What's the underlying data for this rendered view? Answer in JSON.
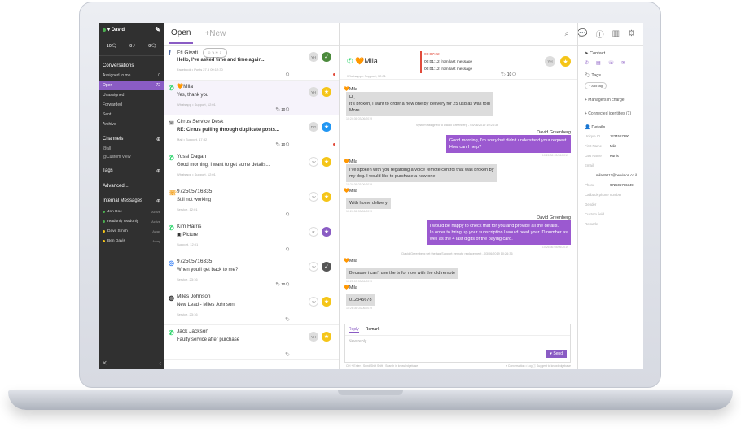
{
  "sidebar": {
    "user": "David",
    "counts": [
      "10🗨",
      "9✓",
      "9🗨"
    ],
    "conversations_h": "Conversations",
    "items": [
      {
        "label": "Assigned to me",
        "count": "0"
      },
      {
        "label": "Open",
        "count": "72"
      },
      {
        "label": "Unassigned",
        "count": ""
      },
      {
        "label": "Forwarded",
        "count": ""
      },
      {
        "label": "Sent",
        "count": ""
      },
      {
        "label": "Archive",
        "count": ""
      }
    ],
    "channels_h": "Channels",
    "channels": [
      "@all",
      "@Custom View"
    ],
    "tags_h": "Tags",
    "advanced": "Advanced...",
    "internal_h": "Internal Messages",
    "internal": [
      {
        "name": "Jon Doe",
        "status": "Active",
        "color": "#4caf50"
      },
      {
        "name": "readonly readonly",
        "status": "Active",
        "color": "#4caf50"
      },
      {
        "name": "Dave Smith",
        "status": "Away",
        "color": "#f5c518"
      },
      {
        "name": "Ben Davis",
        "status": "Away",
        "color": "#f5c518"
      }
    ]
  },
  "list": {
    "tab_open": "Open",
    "tab_new": "+New",
    "rows": [
      {
        "icon": "f",
        "icon_color": "#3b5998",
        "name": "Eti Givati",
        "pill": "☺ ✎ ✂ ⇩",
        "preview": "Hello, I've asked time and time again...",
        "bold": true,
        "meta": "Facebook • Posts 27.5 09:12:30",
        "avatar": "YH",
        "status": "✓",
        "status_color": "#4b8a3c",
        "mini": "🗨",
        "red": true
      },
      {
        "icon": "✆",
        "icon_color": "#25d366",
        "name": "🧡Mila",
        "pill": "",
        "preview": "Yes, thank you",
        "bold": false,
        "meta": "Whatsapp • Support, 12:01",
        "avatar": "YH",
        "status": "★",
        "status_color": "#f5c518",
        "mini": "🏷 10🗨",
        "red": false
      },
      {
        "icon": "✉",
        "icon_color": "#777777",
        "name": "Cirrus Service Desk",
        "pill": "",
        "preview": "RE: Cirrus pulling through duplicate posts...",
        "bold": true,
        "meta": "Mail • Support, 17:32",
        "avatar": "DG",
        "status": "★",
        "status_color": "#2196f3",
        "mini": "🏷 10🗨",
        "red": true
      },
      {
        "icon": "✆",
        "icon_color": "#25d366",
        "name": "Yossi Dagan",
        "pill": "",
        "preview": "Good morning, I want to get some details...",
        "bold": false,
        "meta": "Whatsapp • Support, 12:01",
        "avatar": "JV",
        "status": "★",
        "status_color": "#f5c518",
        "mini": "",
        "red": false
      },
      {
        "icon": "☏",
        "icon_color": "#f39c12",
        "name": "972505716335",
        "pill": "",
        "preview": "Still not working",
        "bold": false,
        "meta": "Service, 12:01",
        "avatar": "JV",
        "status": "★",
        "status_color": "#f5c518",
        "mini": "🗨",
        "red": false
      },
      {
        "icon": "✆",
        "icon_color": "#25d366",
        "name": "Kim Harris",
        "pill": "",
        "preview": "▣ Picture",
        "bold": false,
        "meta": "Support, 12:01",
        "avatar": "R",
        "status": "★",
        "status_color": "#8a5cc4",
        "mini": "🗨",
        "red": false
      },
      {
        "icon": "◎",
        "icon_color": "#3b82f6",
        "name": "972505716335",
        "pill": "",
        "preview": "When you'll get back to me?",
        "bold": false,
        "meta": "Service, 23:16",
        "avatar": "JV",
        "status": "✓",
        "status_color": "#555555",
        "mini": "🏷 10🗨",
        "red": false
      },
      {
        "icon": "◍",
        "icon_color": "#333333",
        "name": "Miles Johnson",
        "pill": "",
        "preview": "New Lead - Miles Johnson",
        "bold": false,
        "meta": "Service, 23:16",
        "avatar": "JV",
        "status": "★",
        "status_color": "#f5c518",
        "mini": "🏷",
        "red": false
      },
      {
        "icon": "✆",
        "icon_color": "#25d366",
        "name": "Jack Jackson",
        "pill": "",
        "preview": "Faulty service after purchase",
        "bold": false,
        "meta": "",
        "avatar": "YH",
        "status": "★",
        "status_color": "#f5c518",
        "mini": "🏷",
        "red": false
      }
    ]
  },
  "conv": {
    "name": "🧡Mila",
    "timers": [
      "00:07:22",
      "00:01:12 from last message",
      "00:01:12 from last message"
    ],
    "sub": "Whatsapp • Support, 12:01",
    "count": "🏷 10🗨",
    "avatar": "YH",
    "messages": [
      {
        "dir": "in",
        "who": "🧡Mila",
        "text": "Hi,\nIt's broken, i want to order a new one by delivery for 25 usd as was told\nMore",
        "time": "10:24:36 03/06/2019"
      },
      {
        "dir": "sys",
        "text": "System assigned to David Greenberg - 03/06/2019 10:24:36"
      },
      {
        "dir": "out",
        "who": "David Greenberg",
        "text": "Good morning, I'm sorry but didn't understand your request.\nHow can I help?",
        "time": "10:26:36 03/06/2019"
      },
      {
        "dir": "in",
        "who": "🧡Mila",
        "text": "I've spoken with you regarding a voice remote control that was broken by\nmy dog. I would like to purchase a new one.",
        "time": "10:24:36 03/06/2019"
      },
      {
        "dir": "in",
        "who": "🧡Mila",
        "text": "With home delivery",
        "time": "10:24:36 03/06/2019"
      },
      {
        "dir": "out",
        "who": "David Greenberg",
        "text": "I would be happy to check that for you and provide all the details.\nIn order to bring up your subscription I would need your ID number as\nwell as the 4 last digits of the paying card.",
        "time": "10:26:36 03/06/2019"
      },
      {
        "dir": "sys",
        "text": "David Greenberg set the tag Support: remote replacement - 03/06/2019 10:26:36"
      },
      {
        "dir": "in",
        "who": "🧡Mila",
        "text": "Because i can't use the tv for now with the old remote",
        "time": "10:25:03 03/06/2019"
      },
      {
        "dir": "in",
        "who": "🧡Mila",
        "text": "012345678",
        "time": "10:26:36 03/06/2019"
      }
    ],
    "reply_tab": "Reply",
    "remark_tab": "Remark",
    "placeholder": "New reply...",
    "send": "▾ Send",
    "foot_left": "Ctrl + Enter - Send   Shift Shift - Search in knowledgebase",
    "foot_right": "▾ Conversation • Log   ⓘ Suggest to knowledgebase"
  },
  "details": {
    "contact": "Contact",
    "tags": "Tags",
    "add_tag": "+ Add tag",
    "managers": "+ Managers in charge",
    "connected": "+ Connected identities (1)",
    "details_h": "Details",
    "fields": [
      {
        "k": "Unique ID",
        "v": "1234567890"
      },
      {
        "k": "First Name",
        "v": "Mila"
      },
      {
        "k": "Last Name",
        "v": "Kunis"
      },
      {
        "k": "Email",
        "v": ""
      },
      {
        "k": "",
        "v": "mila19812@netvision.co.il"
      },
      {
        "k": "Phone",
        "v": "972505716349"
      }
    ],
    "empties": [
      "Callback phone number",
      "Gender",
      "Custom field",
      "Remarks"
    ]
  },
  "colors": {
    "accent": "#8a5cc4",
    "sidebar": "#303030",
    "alert": "#e14b3b"
  }
}
